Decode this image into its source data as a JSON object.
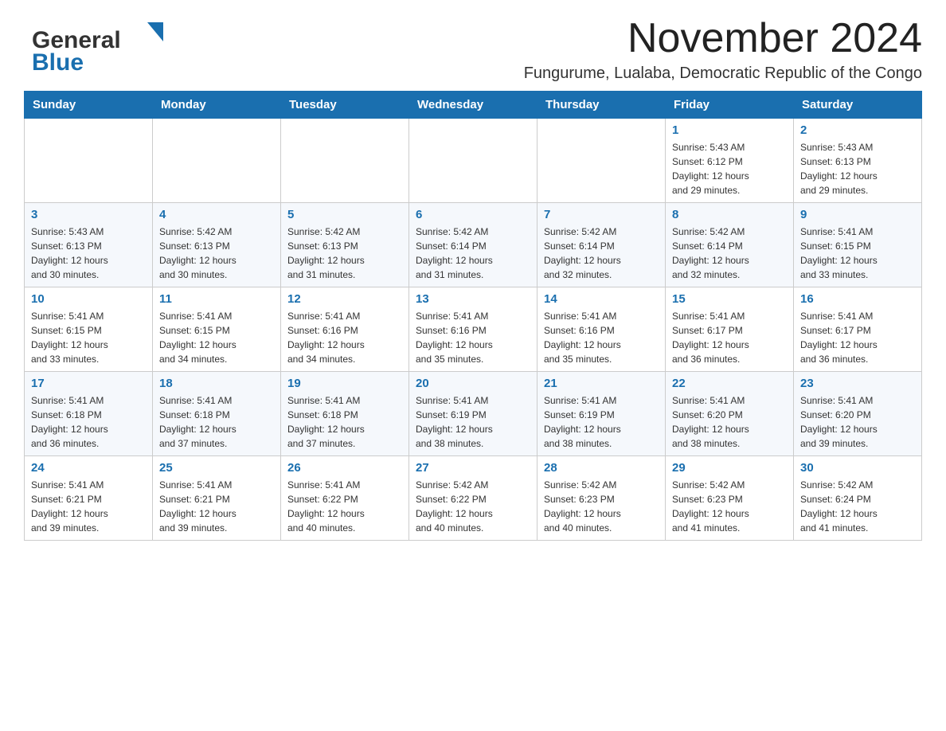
{
  "header": {
    "logo_general": "General",
    "logo_blue": "Blue",
    "month_title": "November 2024",
    "location": "Fungurume, Lualaba, Democratic Republic of the Congo"
  },
  "weekdays": [
    "Sunday",
    "Monday",
    "Tuesday",
    "Wednesday",
    "Thursday",
    "Friday",
    "Saturday"
  ],
  "weeks": [
    [
      {
        "day": "",
        "info": ""
      },
      {
        "day": "",
        "info": ""
      },
      {
        "day": "",
        "info": ""
      },
      {
        "day": "",
        "info": ""
      },
      {
        "day": "",
        "info": ""
      },
      {
        "day": "1",
        "info": "Sunrise: 5:43 AM\nSunset: 6:12 PM\nDaylight: 12 hours\nand 29 minutes."
      },
      {
        "day": "2",
        "info": "Sunrise: 5:43 AM\nSunset: 6:13 PM\nDaylight: 12 hours\nand 29 minutes."
      }
    ],
    [
      {
        "day": "3",
        "info": "Sunrise: 5:43 AM\nSunset: 6:13 PM\nDaylight: 12 hours\nand 30 minutes."
      },
      {
        "day": "4",
        "info": "Sunrise: 5:42 AM\nSunset: 6:13 PM\nDaylight: 12 hours\nand 30 minutes."
      },
      {
        "day": "5",
        "info": "Sunrise: 5:42 AM\nSunset: 6:13 PM\nDaylight: 12 hours\nand 31 minutes."
      },
      {
        "day": "6",
        "info": "Sunrise: 5:42 AM\nSunset: 6:14 PM\nDaylight: 12 hours\nand 31 minutes."
      },
      {
        "day": "7",
        "info": "Sunrise: 5:42 AM\nSunset: 6:14 PM\nDaylight: 12 hours\nand 32 minutes."
      },
      {
        "day": "8",
        "info": "Sunrise: 5:42 AM\nSunset: 6:14 PM\nDaylight: 12 hours\nand 32 minutes."
      },
      {
        "day": "9",
        "info": "Sunrise: 5:41 AM\nSunset: 6:15 PM\nDaylight: 12 hours\nand 33 minutes."
      }
    ],
    [
      {
        "day": "10",
        "info": "Sunrise: 5:41 AM\nSunset: 6:15 PM\nDaylight: 12 hours\nand 33 minutes."
      },
      {
        "day": "11",
        "info": "Sunrise: 5:41 AM\nSunset: 6:15 PM\nDaylight: 12 hours\nand 34 minutes."
      },
      {
        "day": "12",
        "info": "Sunrise: 5:41 AM\nSunset: 6:16 PM\nDaylight: 12 hours\nand 34 minutes."
      },
      {
        "day": "13",
        "info": "Sunrise: 5:41 AM\nSunset: 6:16 PM\nDaylight: 12 hours\nand 35 minutes."
      },
      {
        "day": "14",
        "info": "Sunrise: 5:41 AM\nSunset: 6:16 PM\nDaylight: 12 hours\nand 35 minutes."
      },
      {
        "day": "15",
        "info": "Sunrise: 5:41 AM\nSunset: 6:17 PM\nDaylight: 12 hours\nand 36 minutes."
      },
      {
        "day": "16",
        "info": "Sunrise: 5:41 AM\nSunset: 6:17 PM\nDaylight: 12 hours\nand 36 minutes."
      }
    ],
    [
      {
        "day": "17",
        "info": "Sunrise: 5:41 AM\nSunset: 6:18 PM\nDaylight: 12 hours\nand 36 minutes."
      },
      {
        "day": "18",
        "info": "Sunrise: 5:41 AM\nSunset: 6:18 PM\nDaylight: 12 hours\nand 37 minutes."
      },
      {
        "day": "19",
        "info": "Sunrise: 5:41 AM\nSunset: 6:18 PM\nDaylight: 12 hours\nand 37 minutes."
      },
      {
        "day": "20",
        "info": "Sunrise: 5:41 AM\nSunset: 6:19 PM\nDaylight: 12 hours\nand 38 minutes."
      },
      {
        "day": "21",
        "info": "Sunrise: 5:41 AM\nSunset: 6:19 PM\nDaylight: 12 hours\nand 38 minutes."
      },
      {
        "day": "22",
        "info": "Sunrise: 5:41 AM\nSunset: 6:20 PM\nDaylight: 12 hours\nand 38 minutes."
      },
      {
        "day": "23",
        "info": "Sunrise: 5:41 AM\nSunset: 6:20 PM\nDaylight: 12 hours\nand 39 minutes."
      }
    ],
    [
      {
        "day": "24",
        "info": "Sunrise: 5:41 AM\nSunset: 6:21 PM\nDaylight: 12 hours\nand 39 minutes."
      },
      {
        "day": "25",
        "info": "Sunrise: 5:41 AM\nSunset: 6:21 PM\nDaylight: 12 hours\nand 39 minutes."
      },
      {
        "day": "26",
        "info": "Sunrise: 5:41 AM\nSunset: 6:22 PM\nDaylight: 12 hours\nand 40 minutes."
      },
      {
        "day": "27",
        "info": "Sunrise: 5:42 AM\nSunset: 6:22 PM\nDaylight: 12 hours\nand 40 minutes."
      },
      {
        "day": "28",
        "info": "Sunrise: 5:42 AM\nSunset: 6:23 PM\nDaylight: 12 hours\nand 40 minutes."
      },
      {
        "day": "29",
        "info": "Sunrise: 5:42 AM\nSunset: 6:23 PM\nDaylight: 12 hours\nand 41 minutes."
      },
      {
        "day": "30",
        "info": "Sunrise: 5:42 AM\nSunset: 6:24 PM\nDaylight: 12 hours\nand 41 minutes."
      }
    ]
  ],
  "colors": {
    "header_bg": "#1a6faf",
    "header_text": "#ffffff",
    "day_number": "#1a6faf",
    "border": "#cccccc",
    "row_even": "#f5f8fc"
  }
}
